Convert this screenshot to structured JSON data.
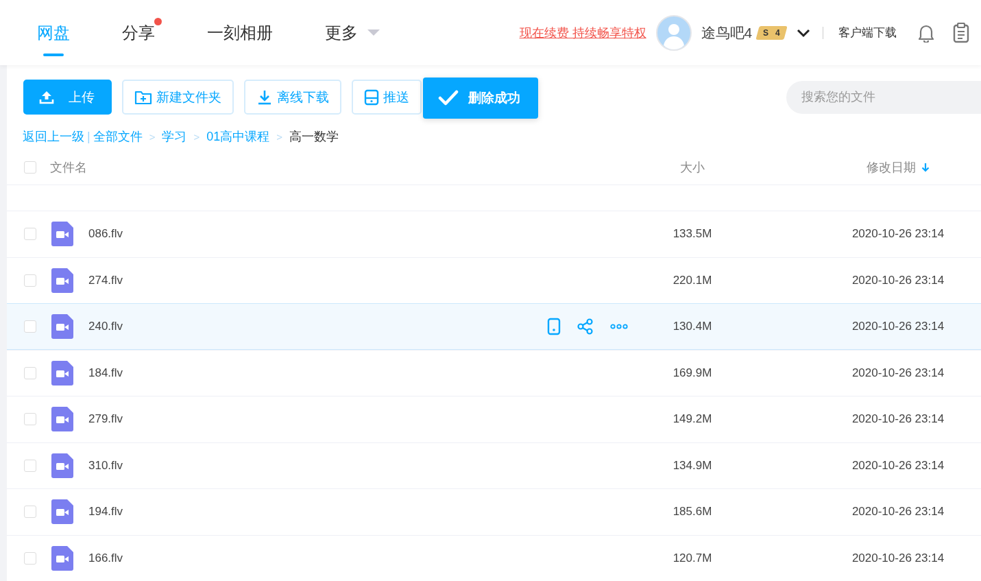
{
  "nav": {
    "tabs": [
      {
        "label": "网盘",
        "selected": true,
        "dot": false,
        "caret": false
      },
      {
        "label": "分享",
        "selected": false,
        "dot": true,
        "caret": false
      },
      {
        "label": "一刻相册",
        "selected": false,
        "dot": false,
        "caret": false
      },
      {
        "label": "更多",
        "selected": false,
        "dot": false,
        "caret": true
      }
    ],
    "renew_link": "现在续费 持续畅享特权",
    "user": {
      "name": "途鸟吧4",
      "badge_letter": "S",
      "badge_level": "4"
    },
    "client_download": "客户端下载"
  },
  "toolbar": {
    "buttons": [
      {
        "label": "上传",
        "kind": "primary"
      },
      {
        "label": "新建文件夹",
        "kind": "folder"
      },
      {
        "label": "离线下载",
        "kind": "download"
      },
      {
        "label": "推送",
        "kind": "push"
      }
    ],
    "search": {
      "placeholder": "搜索您的文件"
    }
  },
  "toast": {
    "text": "删除成功"
  },
  "breadcrumb": {
    "back": "返回上一级",
    "divider": "|",
    "items": [
      {
        "label": "全部文件",
        "current": false
      },
      {
        "separator": ">",
        "label": "学习",
        "current": false
      },
      {
        "separator": ">",
        "label": "01高中课程",
        "current": false
      },
      {
        "separator": ">",
        "label": "高一数学",
        "current": true
      }
    ]
  },
  "table": {
    "columns": [
      "文件名",
      "大小",
      "修改日期"
    ],
    "all_checked": false,
    "rows": [
      {
        "name": "086.flv",
        "size": "133.5M",
        "date": "2020-10-26 23:14",
        "checked": false,
        "hovered": false
      },
      {
        "name": "274.flv",
        "size": "220.1M",
        "date": "2020-10-26 23:14",
        "checked": false,
        "hovered": false
      },
      {
        "name": "240.flv",
        "size": "130.4M",
        "date": "2020-10-26 23:14",
        "checked": false,
        "hovered": true
      },
      {
        "name": "184.flv",
        "size": "169.9M",
        "date": "2020-10-26 23:14",
        "checked": false,
        "hovered": false
      },
      {
        "name": "279.flv",
        "size": "149.2M",
        "date": "2020-10-26 23:14",
        "checked": false,
        "hovered": false
      },
      {
        "name": "310.flv",
        "size": "134.9M",
        "date": "2020-10-26 23:14",
        "checked": false,
        "hovered": false
      },
      {
        "name": "194.flv",
        "size": "185.6M",
        "date": "2020-10-26 23:14",
        "checked": false,
        "hovered": false
      },
      {
        "name": "166.flv",
        "size": "120.7M",
        "date": "2020-10-26 23:14",
        "checked": false,
        "hovered": false
      }
    ]
  }
}
